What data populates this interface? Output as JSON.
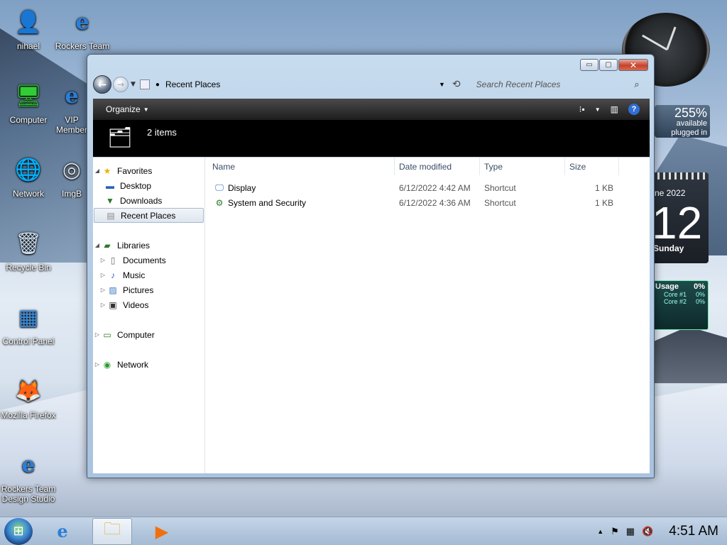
{
  "desktop": {
    "icons": [
      {
        "label": "nihael",
        "glyph": "👤"
      },
      {
        "label": "Rockers Team",
        "glyph": "e"
      },
      {
        "label": "Computer",
        "glyph": "🖥"
      },
      {
        "label": "VIP Member",
        "glyph": "e"
      },
      {
        "label": "Network",
        "glyph": "🌐"
      },
      {
        "label": "ImgB",
        "glyph": "◎"
      },
      {
        "label": "Recycle Bin",
        "glyph": "🗑"
      },
      {
        "label": "Control Panel",
        "glyph": "▦"
      },
      {
        "label": "Mozilla Firefox",
        "glyph": "🦊"
      },
      {
        "label": "Rockers Team Design Studio",
        "glyph": "e"
      }
    ]
  },
  "gadgets": {
    "battery": {
      "percent": "255%",
      "line1": "available",
      "line2": "plugged in"
    },
    "calendar": {
      "month": "ne 2022",
      "day": "12",
      "weekday": "Sunday"
    },
    "cpu": {
      "title": "Usage",
      "total": "0%",
      "cores": [
        {
          "name": "Core #1",
          "value": "0%"
        },
        {
          "name": "Core #2",
          "value": "0%"
        }
      ]
    }
  },
  "window": {
    "controls": {
      "minimize": "▭",
      "maximize": "▢",
      "close": "✕"
    },
    "address": {
      "location": "Recent Places"
    },
    "search": {
      "placeholder": "Search Recent Places"
    },
    "cmdbar": {
      "organize": "Organize"
    },
    "details": {
      "count": "2 items"
    },
    "nav": {
      "favorites": {
        "label": "Favorites",
        "items": [
          "Desktop",
          "Downloads",
          "Recent Places"
        ]
      },
      "libraries": {
        "label": "Libraries",
        "items": [
          "Documents",
          "Music",
          "Pictures",
          "Videos"
        ]
      },
      "computer": "Computer",
      "network": "Network"
    },
    "columns": [
      "Name",
      "Date modified",
      "Type",
      "Size"
    ],
    "files": [
      {
        "name": "Display",
        "date": "6/12/2022 4:42 AM",
        "type": "Shortcut",
        "size": "1 KB"
      },
      {
        "name": "System and Security",
        "date": "6/12/2022 4:36 AM",
        "type": "Shortcut",
        "size": "1 KB"
      }
    ]
  },
  "taskbar": {
    "clock": "4:51 AM"
  }
}
